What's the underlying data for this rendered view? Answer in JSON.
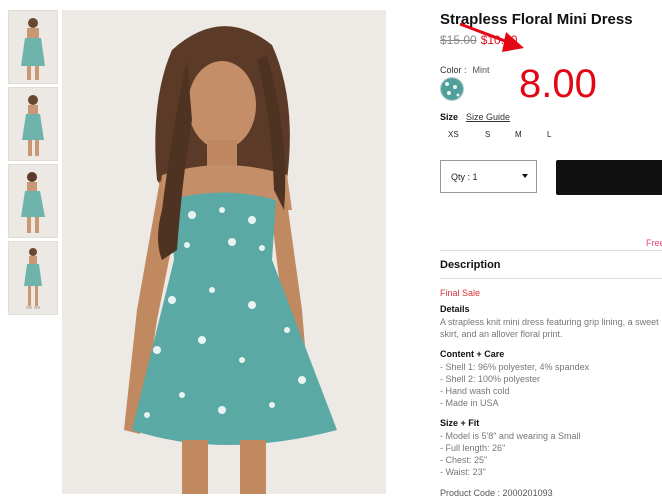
{
  "product": {
    "title": "Strapless Floral Mini Dress",
    "old_price": "$15.00",
    "new_price": "$10.00",
    "annotation_price": "8.00",
    "color_label": "Color",
    "color_value": "Mint",
    "size_label": "Size",
    "size_guide": "Size Guide",
    "sizes": [
      "XS",
      "S",
      "M",
      "L"
    ],
    "quantity": "Qty : 1",
    "free_text": "Free"
  },
  "description": {
    "heading": "Description",
    "final_sale": "Final Sale",
    "details_heading": "Details",
    "details_lines": [
      "A strapless knit mini dress featuring grip lining, a sweet",
      "skirt, and an allover floral print."
    ],
    "content_heading": "Content + Care",
    "content_lines": [
      "- Shell 1: 96% polyester, 4% spandex",
      "- Shell 2: 100% polyester",
      "- Hand wash cold",
      "- Made in USA"
    ],
    "fit_heading": "Size + Fit",
    "fit_lines": [
      "- Model is 5'8\" and wearing a Small",
      "- Full length: 26\"",
      "- Chest: 25\"",
      "- Waist: 23\""
    ],
    "product_code": "Product Code : 2000201093"
  },
  "colors": {
    "sale_red": "#e0101a",
    "annotation_red": "#e30613",
    "dress_teal": "#5aa9a4",
    "button_black": "#111111"
  },
  "icons": [
    "dress-swatch-icon",
    "dropdown-caret-icon",
    "red-arrow-annotation"
  ]
}
